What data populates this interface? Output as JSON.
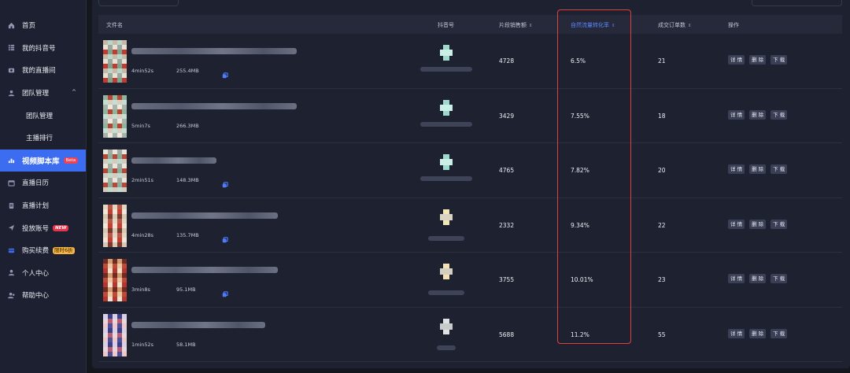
{
  "sidebar": {
    "items": [
      {
        "label": "首页",
        "icon": "home-icon"
      },
      {
        "label": "我的抖音号",
        "icon": "list-icon"
      },
      {
        "label": "我的直播间",
        "icon": "video-icon"
      },
      {
        "label": "团队管理",
        "icon": "team-icon",
        "expanded": true
      },
      {
        "label": "团队管理",
        "sub": true
      },
      {
        "label": "主播排行",
        "sub": true
      },
      {
        "label": "视频脚本库",
        "icon": "chart-icon",
        "active": true,
        "badge": "Beta"
      },
      {
        "label": "直播日历",
        "icon": "calendar-icon"
      },
      {
        "label": "直播计划",
        "icon": "document-icon"
      },
      {
        "label": "投放账号",
        "icon": "send-icon",
        "badge": "NEW"
      },
      {
        "label": "购买续费",
        "icon": "card-icon",
        "badge": "限时6折"
      },
      {
        "label": "个人中心",
        "icon": "user-icon"
      },
      {
        "label": "帮助中心",
        "icon": "help-icon"
      }
    ]
  },
  "table": {
    "headers": {
      "file": "文件名",
      "account": "抖音号",
      "sales": "片段销售额",
      "conversion": "自然流量转化率",
      "orders": "成交订单数",
      "actions": "操作"
    },
    "sort_icon": "⇕",
    "action_labels": {
      "detail": "详 情",
      "delete": "删 除",
      "download": "下 载"
    },
    "rows": [
      {
        "duration": "4min52s",
        "size": "255.4MB",
        "sales": "4728",
        "conversion": "6.5%",
        "orders": "21",
        "has_copy": true
      },
      {
        "duration": "5min7s",
        "size": "266.3MB",
        "sales": "3429",
        "conversion": "7.55%",
        "orders": "18",
        "has_copy": false
      },
      {
        "duration": "2min51s",
        "size": "148.3MB",
        "sales": "4765",
        "conversion": "7.82%",
        "orders": "20",
        "has_copy": true
      },
      {
        "duration": "4min28s",
        "size": "135.7MB",
        "sales": "2332",
        "conversion": "9.34%",
        "orders": "22",
        "has_copy": true
      },
      {
        "duration": "3min8s",
        "size": "95.1MB",
        "sales": "3755",
        "conversion": "10.01%",
        "orders": "23",
        "has_copy": true
      },
      {
        "duration": "1min52s",
        "size": "58.1MB",
        "sales": "5688",
        "conversion": "11.2%",
        "orders": "55",
        "has_copy": false
      }
    ]
  },
  "colors": {
    "accent": "#3c6cf0",
    "highlight_box": "#e0413f",
    "sort_active": "#5b86ff"
  }
}
